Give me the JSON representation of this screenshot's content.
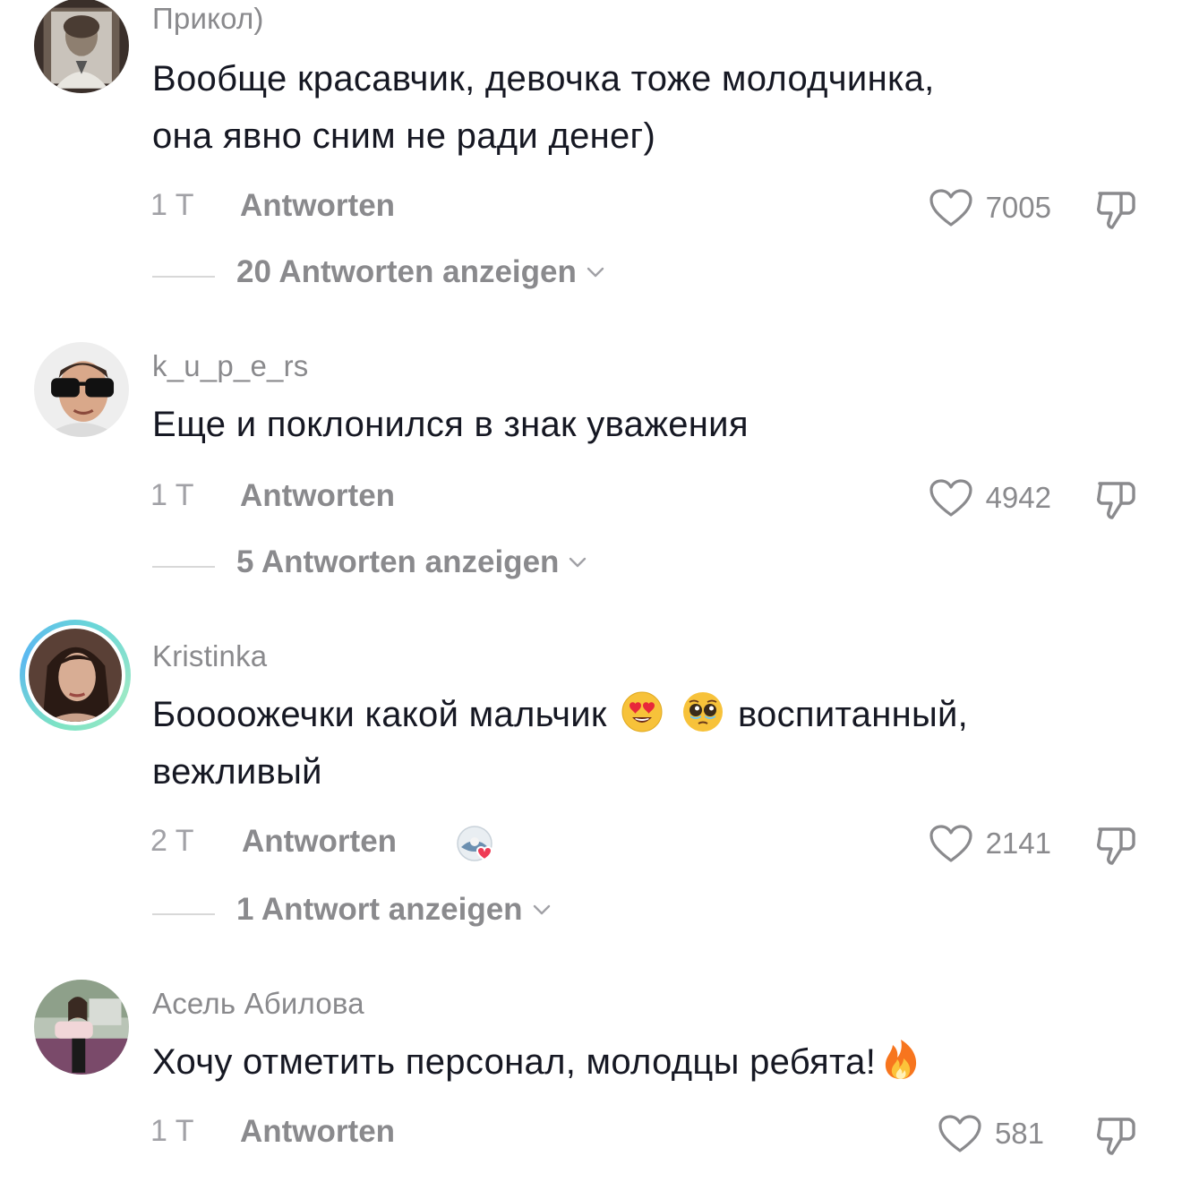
{
  "comments": [
    {
      "username": "Прикол)",
      "text_lines": [
        "Вообще красавчик, девочка тоже молодчинка,",
        "она явно сним не ради денег)"
      ],
      "time": "1 T",
      "reply_label": "Antworten",
      "likes": "7005",
      "view_replies": "20 Antworten anzeigen"
    },
    {
      "username": "k_u_p_e_rs",
      "text_lines": [
        "Еще и поклонился в знак уважения"
      ],
      "time": "1 T",
      "reply_label": "Antworten",
      "likes": "4942",
      "view_replies": "5 Antworten anzeigen"
    },
    {
      "username": "Kristinka",
      "text_line1_before": "Боооожечки какой мальчик",
      "text_line1_after": "воспитанный,",
      "text_line2": "вежливый",
      "emojis": [
        "heart-eyes-emoji",
        "pleading-face-emoji"
      ],
      "time": "2 T",
      "reply_label": "Antworten",
      "likes": "2141",
      "view_replies": "1 Antwort anzeigen"
    },
    {
      "username": "Асель Абилова",
      "text_line": "Хочу отметить персонал, молодцы ребята!",
      "emojis": [
        "fire-emoji"
      ],
      "time": "1 T",
      "reply_label": "Antworten",
      "likes": "581"
    }
  ],
  "colors": {
    "text": "#161823",
    "secondary": "#8a8a8d",
    "ring_start": "#7de3c4",
    "ring_end": "#5bb8f0"
  },
  "icons": [
    "heart-outline-icon",
    "thumbs-down-icon",
    "chevron-down-icon"
  ]
}
